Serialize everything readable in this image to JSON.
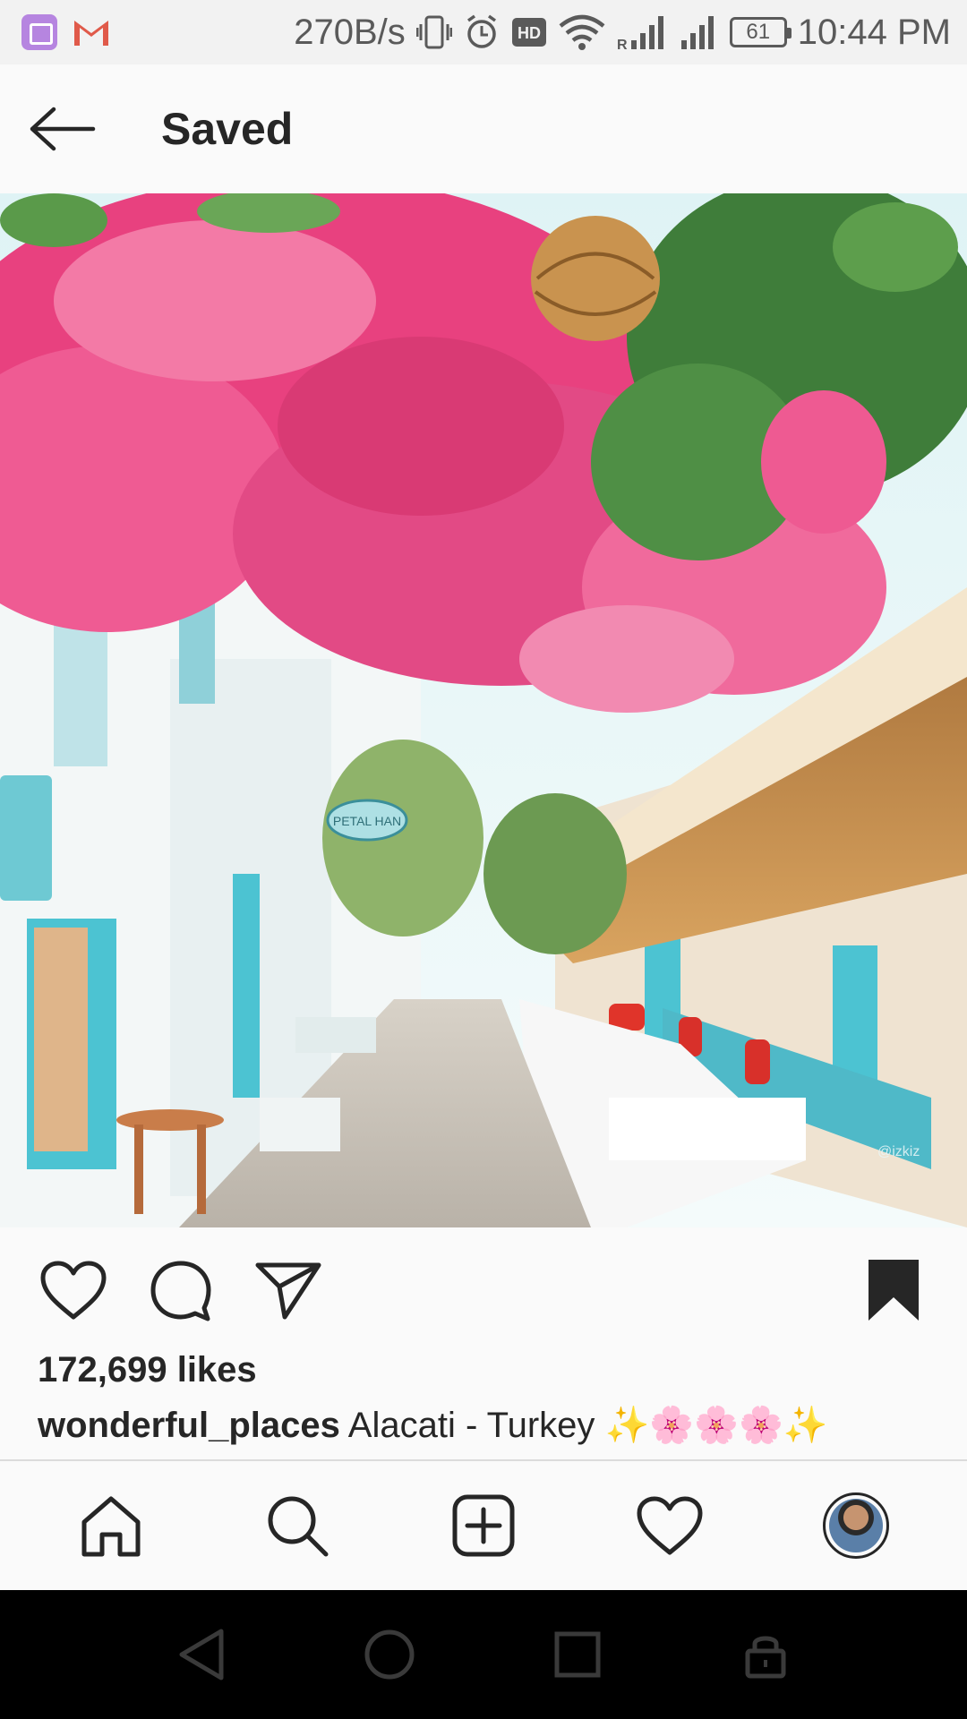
{
  "status_bar": {
    "network_speed": "270B/s",
    "battery_level": "61",
    "time": "10:44 PM",
    "icons": [
      "gallery-app-icon",
      "gmail-icon",
      "vibrate-icon",
      "alarm-icon",
      "hd-icon",
      "wifi-icon",
      "signal-roaming-icon",
      "signal-icon",
      "battery-icon"
    ]
  },
  "header": {
    "title": "Saved",
    "back_icon": "arrow-left-icon"
  },
  "post": {
    "actions": {
      "like_icon": "heart-icon",
      "comment_icon": "comment-icon",
      "share_icon": "send-icon",
      "save_icon": "bookmark-filled-icon"
    },
    "likes_text": "172,699 likes",
    "caption": {
      "username": "wonderful_places",
      "text": "Alacati - Turkey",
      "emoji": "✨🌸🌸🌸✨"
    },
    "photo_watermark": "@izkiz",
    "photo_sign": "PETAL HAN"
  },
  "bottom_nav": {
    "items": [
      {
        "icon": "home-icon"
      },
      {
        "icon": "search-icon"
      },
      {
        "icon": "new-post-icon"
      },
      {
        "icon": "activity-heart-icon"
      },
      {
        "icon": "profile-avatar"
      }
    ]
  },
  "system_nav": {
    "items": [
      "back-triangle-icon",
      "home-circle-icon",
      "recents-square-icon",
      "lock-icon"
    ]
  },
  "colors": {
    "status_bar_bg": "#f2f2f2",
    "app_bg": "#fafafa",
    "text_primary": "#262626",
    "system_nav_bg": "#000000",
    "flowers_pink": "#e8417f",
    "turquoise": "#4cc3d2"
  }
}
